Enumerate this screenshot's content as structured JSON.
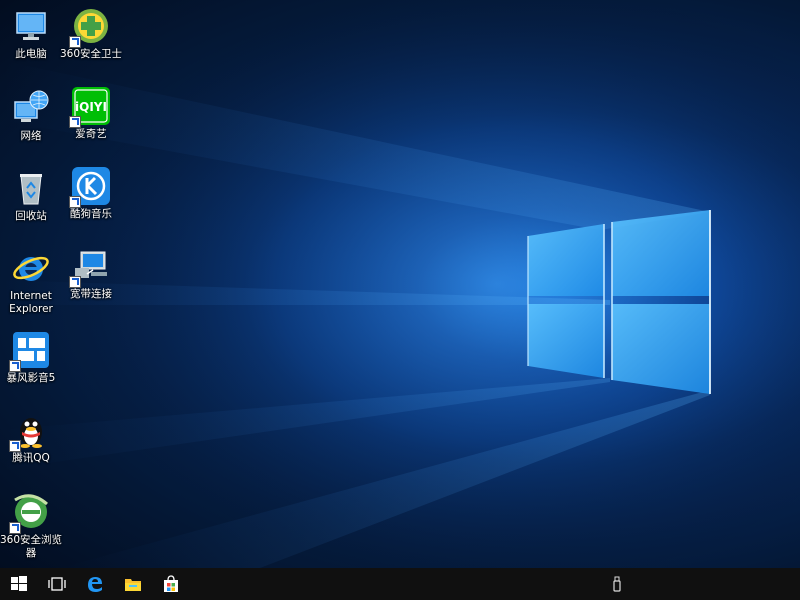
{
  "desktop": {
    "icons": [
      {
        "label": "此电脑",
        "icon": "computer-icon"
      },
      {
        "label": "网络",
        "icon": "network-icon"
      },
      {
        "label": "回收站",
        "icon": "recycle-bin-icon"
      },
      {
        "label": "Internet Explorer",
        "icon": "internet-explorer-icon"
      },
      {
        "label": "暴风影音5",
        "icon": "baofeng-player-icon"
      },
      {
        "label": "腾讯QQ",
        "icon": "qq-penguin-icon"
      },
      {
        "label": "360安全浏览器",
        "icon": "360-browser-icon"
      },
      {
        "label": "360安全卫士",
        "icon": "360-security-icon"
      },
      {
        "label": "爱奇艺",
        "icon": "iqiyi-icon"
      },
      {
        "label": "酷狗音乐",
        "icon": "kugou-music-icon"
      },
      {
        "label": "宽带连接",
        "icon": "broadband-connection-icon"
      }
    ]
  },
  "taskbar": {
    "items": [
      "start-icon",
      "task-view-icon",
      "edge-icon",
      "file-explorer-icon",
      "store-icon"
    ],
    "tray": "usb-device-icon"
  },
  "colors": {
    "taskbar": "#101010",
    "window_light": "#48b4ff"
  }
}
